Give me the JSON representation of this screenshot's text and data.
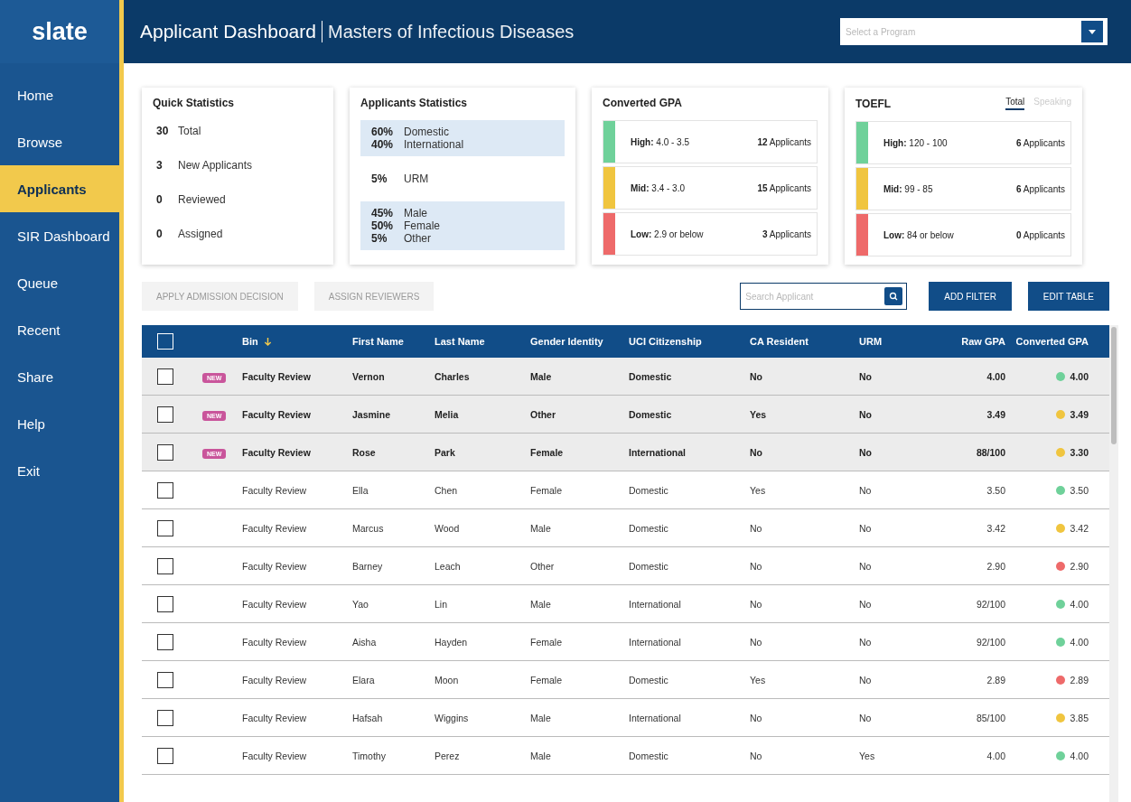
{
  "logo": "slate",
  "header": {
    "title": "Applicant Dashboard",
    "subtitle": "Masters of Infectious Diseases",
    "program_select": {
      "placeholder": "Select a Program"
    }
  },
  "sidebar": {
    "items": [
      {
        "label": "Home",
        "selected": false
      },
      {
        "label": "Browse",
        "selected": false
      },
      {
        "label": "Applicants",
        "selected": true
      },
      {
        "label": "SIR Dashboard",
        "selected": false
      },
      {
        "label": "Queue",
        "selected": false
      },
      {
        "label": "Recent",
        "selected": false
      },
      {
        "label": "Share",
        "selected": false
      },
      {
        "label": "Help",
        "selected": false
      },
      {
        "label": "Exit",
        "selected": false
      }
    ]
  },
  "quick_statistics": {
    "title": "Quick Statistics",
    "items": [
      {
        "value": "30",
        "label": "Total"
      },
      {
        "value": "3",
        "label": "New Applicants"
      },
      {
        "value": "0",
        "label": "Reviewed"
      },
      {
        "value": "0",
        "label": "Assigned"
      }
    ]
  },
  "applicants_statistics": {
    "title": "Applicants Statistics",
    "groups": [
      {
        "shaded": true,
        "items": [
          {
            "value": "60%",
            "label": "Domestic"
          },
          {
            "value": "40%",
            "label": "International"
          }
        ]
      },
      {
        "shaded": false,
        "items": [
          {
            "value": "5%",
            "label": "URM"
          }
        ]
      },
      {
        "shaded": true,
        "items": [
          {
            "value": "45%",
            "label": "Male"
          },
          {
            "value": "50%",
            "label": "Female"
          },
          {
            "value": "5%",
            "label": "Other"
          }
        ]
      }
    ]
  },
  "converted_gpa": {
    "title": "Converted GPA",
    "bands": [
      {
        "name": "High:",
        "range": "4.0 - 3.5",
        "count": "12",
        "unit": "Applicants",
        "color": "#6fd19a"
      },
      {
        "name": "Mid:",
        "range": "3.4 - 3.0",
        "count": "15",
        "unit": "Applicants",
        "color": "#f0c53f"
      },
      {
        "name": "Low:",
        "range": "2.9 or below",
        "count": "3",
        "unit": "Applicants",
        "color": "#ee6a6a"
      }
    ]
  },
  "toefl": {
    "title": "TOEFL",
    "tabs": [
      {
        "label": "Total",
        "selected": true
      },
      {
        "label": "Speaking",
        "selected": false
      }
    ],
    "bands": [
      {
        "name": "High:",
        "range": "120 - 100",
        "count": "6",
        "unit": "Applicants",
        "color": "#6fd19a"
      },
      {
        "name": "Mid:",
        "range": "99 - 85",
        "count": "6",
        "unit": "Applicants",
        "color": "#f0c53f"
      },
      {
        "name": "Low:",
        "range": "84 or below",
        "count": "0",
        "unit": "Applicants",
        "color": "#ee6a6a"
      }
    ]
  },
  "actions": [
    {
      "label": "APPLY ADMISSION DECISION",
      "disabled": true
    },
    {
      "label": "ASSIGN REVIEWERS",
      "disabled": true
    }
  ],
  "search": {
    "placeholder": "Search Applicant"
  },
  "buttons": [
    "ADD FILTER",
    "EDIT TABLE"
  ],
  "table": {
    "select_all_checked": false,
    "columns": [
      "Bin",
      "First Name",
      "Last Name",
      "Gender Identity",
      "UCI Citizenship",
      "CA Resident",
      "URM",
      "Raw GPA",
      "Converted GPA"
    ],
    "rows": [
      {
        "new": true,
        "badge": "NEW",
        "checked": false,
        "cells": [
          "Faculty Review",
          "Vernon",
          "Charles",
          "Male",
          "Domestic",
          "No",
          "No",
          "4.00",
          "4.00"
        ],
        "color": "#6fd19a"
      },
      {
        "new": true,
        "badge": "NEW",
        "checked": false,
        "cells": [
          "Faculty Review",
          "Jasmine",
          "Melia",
          "Other",
          "Domestic",
          "Yes",
          "No",
          "3.49",
          "3.49"
        ],
        "color": "#f0c53f"
      },
      {
        "new": true,
        "badge": "NEW",
        "checked": false,
        "cells": [
          "Faculty Review",
          "Rose",
          "Park",
          "Female",
          "International",
          "No",
          "No",
          "88/100",
          "3.30"
        ],
        "color": "#f0c53f"
      },
      {
        "new": false,
        "checked": false,
        "cells": [
          "Faculty Review",
          "Ella",
          "Chen",
          "Female",
          "Domestic",
          "Yes",
          "No",
          "3.50",
          "3.50"
        ],
        "color": "#6fd19a"
      },
      {
        "new": false,
        "checked": false,
        "cells": [
          "Faculty Review",
          "Marcus",
          "Wood",
          "Male",
          "Domestic",
          "No",
          "No",
          "3.42",
          "3.42"
        ],
        "color": "#f0c53f"
      },
      {
        "new": false,
        "checked": false,
        "cells": [
          "Faculty Review",
          "Barney",
          "Leach",
          "Other",
          "Domestic",
          "No",
          "No",
          "2.90",
          "2.90"
        ],
        "color": "#ee6a6a"
      },
      {
        "new": false,
        "checked": false,
        "cells": [
          "Faculty Review",
          "Yao",
          "Lin",
          "Male",
          "International",
          "No",
          "No",
          "92/100",
          "4.00"
        ],
        "color": "#6fd19a"
      },
      {
        "new": false,
        "checked": false,
        "cells": [
          "Faculty Review",
          "Aisha",
          "Hayden",
          "Female",
          "International",
          "No",
          "No",
          "92/100",
          "4.00"
        ],
        "color": "#6fd19a"
      },
      {
        "new": false,
        "checked": false,
        "cells": [
          "Faculty Review",
          "Elara",
          "Moon",
          "Female",
          "Domestic",
          "Yes",
          "No",
          "2.89",
          "2.89"
        ],
        "color": "#ee6a6a"
      },
      {
        "new": false,
        "checked": false,
        "cells": [
          "Faculty Review",
          "Hafsah",
          "Wiggins",
          "Male",
          "International",
          "No",
          "No",
          "85/100",
          "3.85"
        ],
        "color": "#f0c53f"
      },
      {
        "new": false,
        "checked": false,
        "cells": [
          "Faculty Review",
          "Timothy",
          "Perez",
          "Male",
          "Domestic",
          "No",
          "Yes",
          "4.00",
          "4.00"
        ],
        "color": "#6fd19a"
      }
    ]
  }
}
